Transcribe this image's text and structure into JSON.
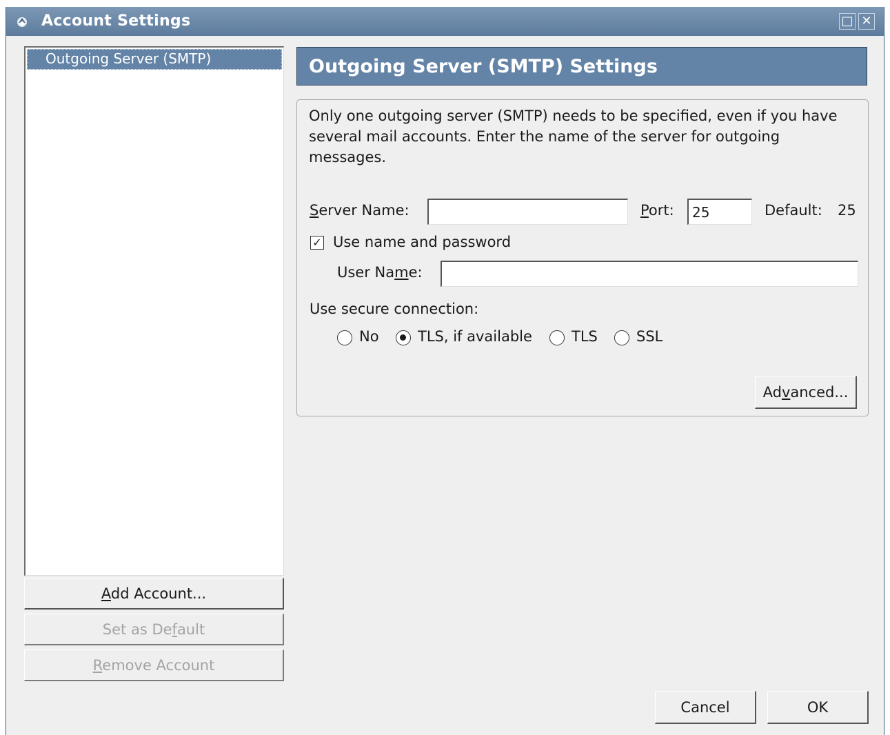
{
  "window": {
    "title": "Account Settings",
    "maximize_glyph": "□",
    "close_glyph": "✕"
  },
  "accounts": {
    "items": [
      {
        "label": "Outgoing Server (SMTP)",
        "selected": true
      }
    ]
  },
  "side_buttons": {
    "add": {
      "pre": "",
      "u": "A",
      "post": "dd Account..."
    },
    "set_default": {
      "pre": "Set as De",
      "u": "f",
      "post": "ault"
    },
    "remove": {
      "pre": "",
      "u": "R",
      "post": "emove Account"
    }
  },
  "panel": {
    "header": "Outgoing Server (SMTP) Settings",
    "description": "Only one outgoing server (SMTP) needs to be specified, even if you have several mail accounts. Enter the name of the server for outgoing messages."
  },
  "form": {
    "server_label": {
      "pre": "",
      "u": "S",
      "post": "erver Name:"
    },
    "server_value": "",
    "port_label": {
      "pre": "",
      "u": "P",
      "post": "ort:"
    },
    "port_value": "25",
    "default_label": "Default:",
    "default_value": "25",
    "use_auth_label": "Use name and password",
    "use_auth_checked": true,
    "check_glyph": "✓",
    "username_label": {
      "pre": "User Na",
      "u": "m",
      "post": "e:"
    },
    "username_value": "",
    "secure_label": "Use secure connection:",
    "secure_options": [
      {
        "label": "No",
        "selected": false
      },
      {
        "label": "TLS, if available",
        "selected": true
      },
      {
        "label": "TLS",
        "selected": false
      },
      {
        "label": "SSL",
        "selected": false
      }
    ],
    "advanced": {
      "pre": "Ad",
      "u": "v",
      "post": "anced..."
    }
  },
  "footer": {
    "cancel": "Cancel",
    "ok": "OK"
  },
  "colors": {
    "titlebar": "#6383a7",
    "header": "#6383a7",
    "background": "#efefef"
  }
}
